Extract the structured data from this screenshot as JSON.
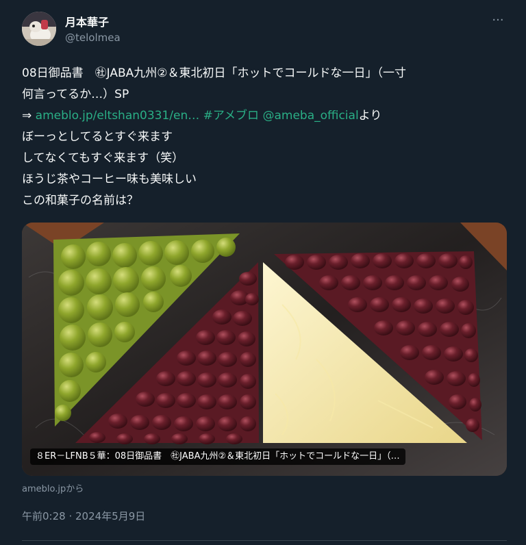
{
  "author": {
    "display_name": "月本華子",
    "handle": "@telolmea"
  },
  "more_label": "···",
  "tweet": {
    "line1": "08日御品書　㊓JABA九州②＆東北初日「ホットでコールドな一日」（一寸",
    "line2": "何言ってるか…）SP",
    "arrow": "⇒ ",
    "link_url": "ameblo.jp/eltshan0331/en…",
    "hashtag": "#アメブロ",
    "mention": "@ameba_official",
    "after_mention": "より",
    "line4": "ぼーっとしてるとすぐ来ます",
    "line5": "してなくてもすぐ来ます（笑）",
    "line6": "ほうじ茶やコーヒー味も美味しい",
    "line7": "この和菓子の名前は？"
  },
  "card": {
    "caption": "８ER－LFNB５華：08日御品書　㊓JABA九州②＆東北初日「ホットでコールドな一日」（…",
    "source": "ameblo.jpから"
  },
  "timestamp": "午前0:28 · 2024年5月9日",
  "colors": {
    "background": "#15202b",
    "link": "#2aaf86",
    "secondary_text": "#8b98a5"
  }
}
